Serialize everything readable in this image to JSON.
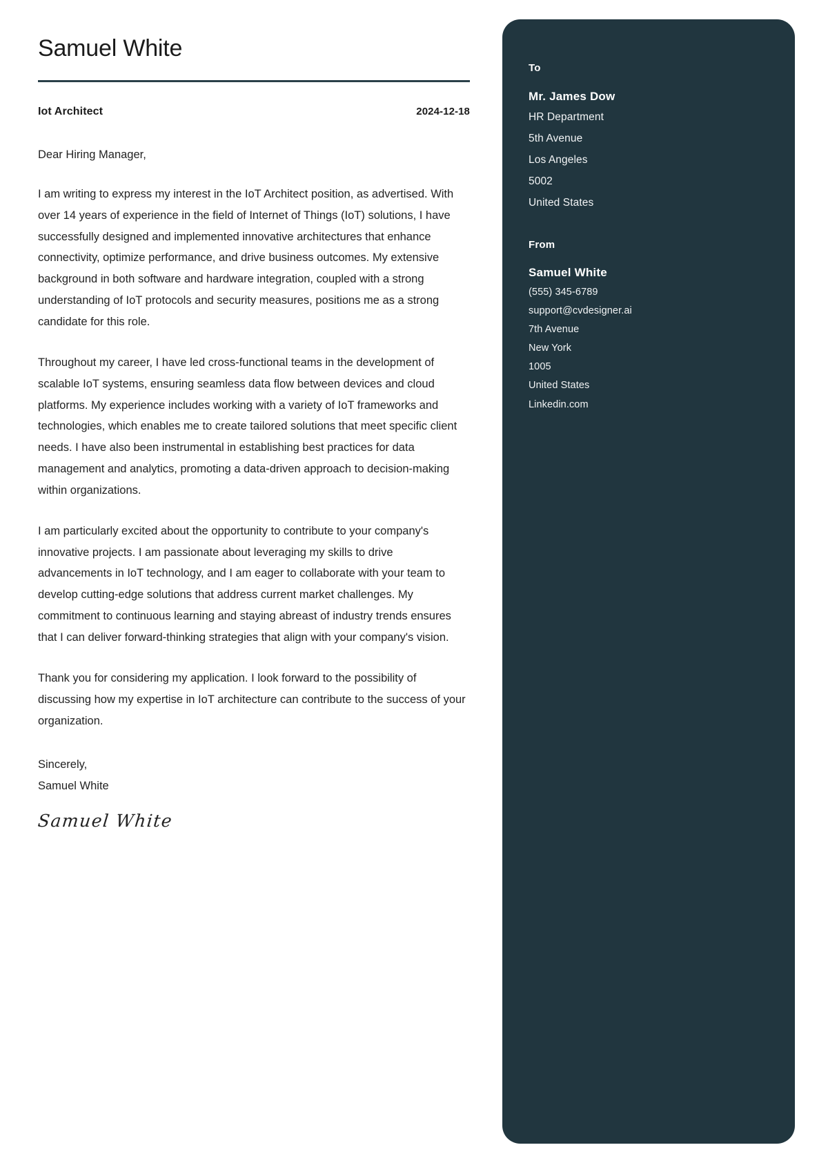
{
  "theme": {
    "sidebar_bg": "#21363f",
    "rule_color": "#2a4049",
    "page_bg": "#ffffff",
    "body_text": "#232323"
  },
  "letter": {
    "applicant_name": "Samuel White",
    "job_title": "Iot Architect",
    "date": "2024-12-18",
    "salutation": "Dear Hiring Manager,",
    "paragraphs": [
      "I am writing to express my interest in the IoT Architect position, as advertised. With over 14 years of experience in the field of Internet of Things (IoT) solutions, I have successfully designed and implemented innovative architectures that enhance connectivity, optimize performance, and drive business outcomes. My extensive background in both software and hardware integration, coupled with a strong understanding of IoT protocols and security measures, positions me as a strong candidate for this role.",
      "Throughout my career, I have led cross-functional teams in the development of scalable IoT systems, ensuring seamless data flow between devices and cloud platforms. My experience includes working with a variety of IoT frameworks and technologies, which enables me to create tailored solutions that meet specific client needs. I have also been instrumental in establishing best practices for data management and analytics, promoting a data-driven approach to decision-making within organizations.",
      "I am particularly excited about the opportunity to contribute to your company's innovative projects. I am passionate about leveraging my skills to drive advancements in IoT technology, and I am eager to collaborate with your team to develop cutting-edge solutions that address current market challenges. My commitment to continuous learning and staying abreast of industry trends ensures that I can deliver forward-thinking strategies that align with your company's vision.",
      "Thank you for considering my application. I look forward to the possibility of discussing how my expertise in IoT architecture can contribute to the success of your organization."
    ],
    "closing_salutation": "Sincerely,",
    "closing_name": "Samuel White",
    "signature_script": "Samuel White"
  },
  "sidebar": {
    "to": {
      "heading": "To",
      "name": "Mr. James Dow",
      "lines": [
        "HR Department",
        "5th Avenue",
        "Los Angeles",
        "5002",
        "United States"
      ]
    },
    "from": {
      "heading": "From",
      "name": "Samuel White",
      "lines": [
        "(555) 345-6789",
        "support@cvdesigner.ai",
        "7th Avenue",
        "New York",
        "1005",
        "United States",
        "Linkedin.com"
      ]
    }
  }
}
